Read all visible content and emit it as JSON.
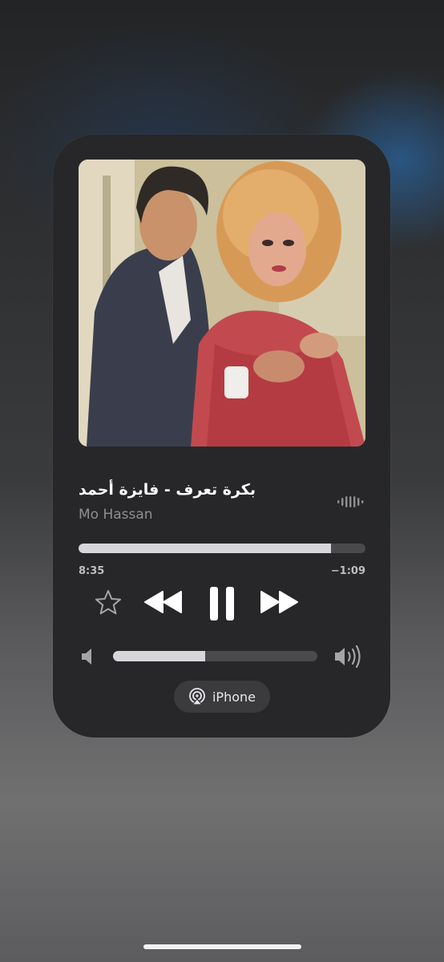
{
  "now_playing": {
    "title": "بكرة تعرف - فايزة أحمد",
    "artist": "Mo Hassan",
    "progress": {
      "elapsed": "8:35",
      "remaining": "−1:09",
      "fraction": 0.88
    },
    "volume": {
      "fraction": 0.45
    },
    "output_device": {
      "label": "iPhone"
    }
  },
  "icons": {
    "favorite": "star-icon",
    "rewind": "rewind-icon",
    "pause": "pause-icon",
    "forward": "fast-forward-icon",
    "volume_low": "speaker-low-icon",
    "volume_high": "speaker-high-icon",
    "airplay": "airplay-icon",
    "waveform": "waveform-icon"
  },
  "colors": {
    "card": "#272729",
    "fill": "#d7d7db",
    "track": "#4a4a4d"
  }
}
